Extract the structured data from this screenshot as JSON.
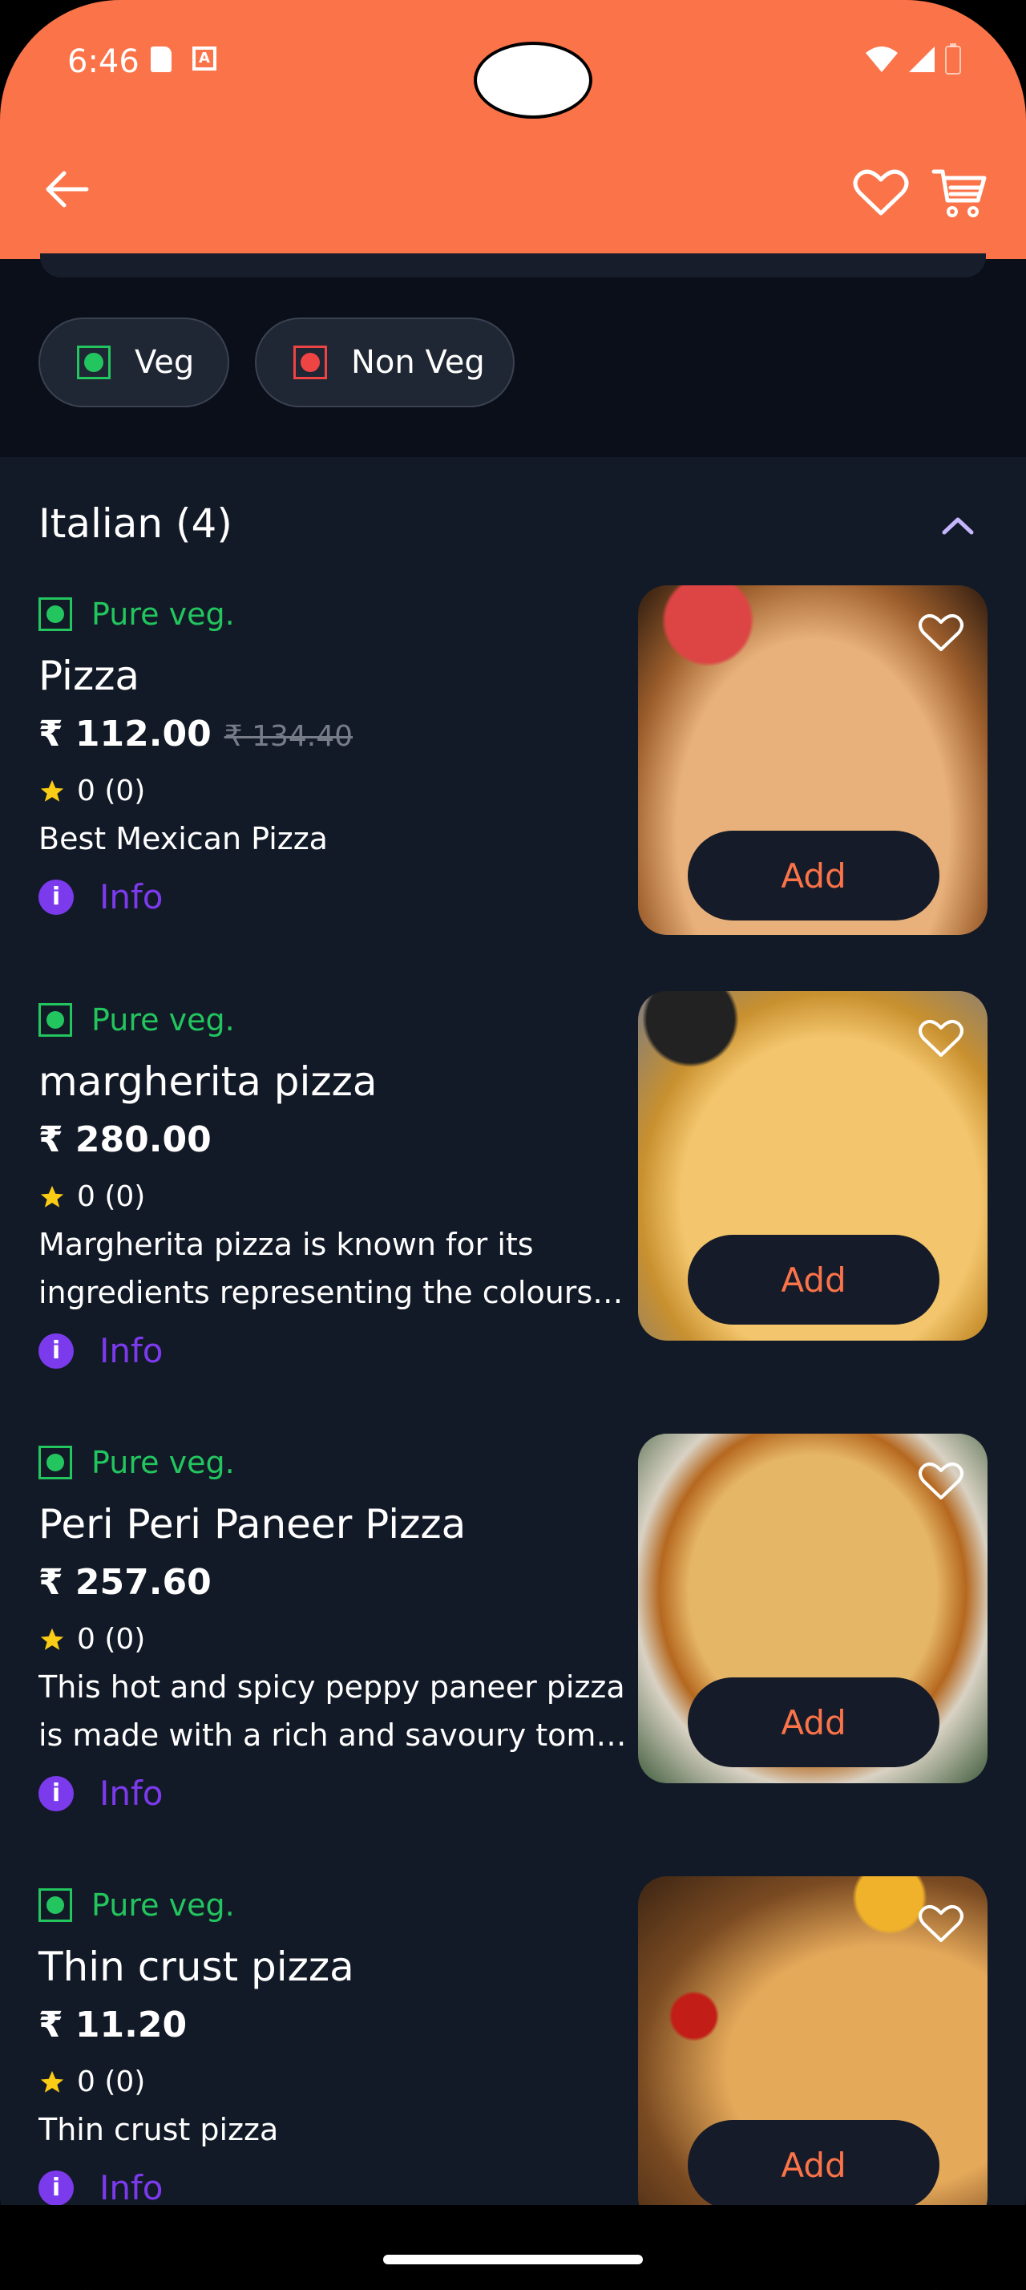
{
  "status_bar": {
    "time": "6:46"
  },
  "filters": {
    "veg_label": "Veg",
    "nonveg_label": "Non Veg"
  },
  "section": {
    "title": "Italian (4)"
  },
  "colors": {
    "accent": "#fb7349",
    "veg_green": "#22c55e",
    "nonveg_red": "#ef4444",
    "info_purple": "#7c3aed",
    "star_yellow": "#facc15"
  },
  "items": [
    {
      "tag": "Pure veg.",
      "name": "Pizza",
      "price": "₹ 112.00",
      "old_price": "₹ 134.40",
      "rating": "0 (0)",
      "desc_1": "Best Mexican Pizza",
      "desc_2": "",
      "info": "Info",
      "add": "Add"
    },
    {
      "tag": "Pure veg.",
      "name": "margherita pizza",
      "price": "₹ 280.00",
      "rating": "0 (0)",
      "desc_1": "Margherita pizza is known for its",
      "desc_2": "ingredients representing the colours o...",
      "info": "Info",
      "add": "Add"
    },
    {
      "tag": "Pure veg.",
      "name": "Peri Peri Paneer Pizza",
      "price": "₹ 257.60",
      "rating": "0 (0)",
      "desc_1": "This hot and spicy peppy paneer pizza",
      "desc_2": "is made with a rich and savoury toma...",
      "info": "Info",
      "add": "Add"
    },
    {
      "tag": "Pure veg.",
      "name": "Thin crust pizza",
      "price": "₹ 11.20",
      "rating": "0 (0)",
      "desc_1": "Thin crust pizza",
      "desc_2": "",
      "info": "Info",
      "add": "Add"
    }
  ]
}
